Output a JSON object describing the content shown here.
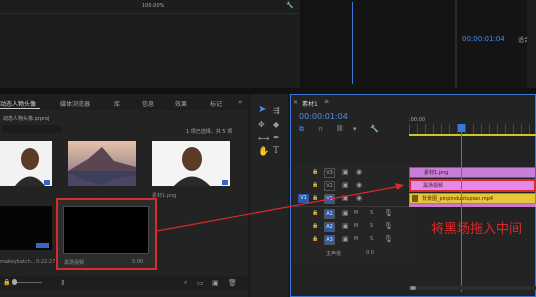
{
  "top": {
    "zoom": "100.00%",
    "program_timecode": "00:00:01:04",
    "program_fit": "适合"
  },
  "project_panel": {
    "tabs": [
      "动态人物头像",
      "媒体浏览器",
      "库",
      "信息",
      "效果",
      "标记"
    ],
    "project_file": "动态人物头像.prproj",
    "selection_count": "1 项已选择，共 5 项",
    "items": [
      {
        "label": "",
        "duration": ""
      },
      {
        "label": "",
        "duration": ""
      },
      {
        "label": "素材1.png",
        "duration": ""
      },
      {
        "label": "makeybatch...",
        "duration": "0:22:27"
      },
      {
        "label": "黑场视频",
        "duration": "5:00"
      }
    ]
  },
  "timeline": {
    "tab": "素材1",
    "timecode": "00:00:01:04",
    "ruler_start": ":00:00",
    "tracks": [
      "V3",
      "V2",
      "V1",
      "A1",
      "A2",
      "A3"
    ],
    "master": "主声道",
    "master_value": "0.0",
    "clips": [
      {
        "label": "素材1.png",
        "color": "#c87ed6",
        "track": "V3"
      },
      {
        "label": "黑场视频",
        "color": "#e58ae8",
        "track": "V2"
      },
      {
        "label": "背景图_pinpinduotupian.mp4",
        "color": "#e8c53a",
        "track": "V1"
      }
    ]
  },
  "annotation": "将黑场拖入中间",
  "colors": {
    "accent": "#4a8ff0",
    "annotation": "#d92b2b",
    "playhead": "#3d78d8"
  }
}
